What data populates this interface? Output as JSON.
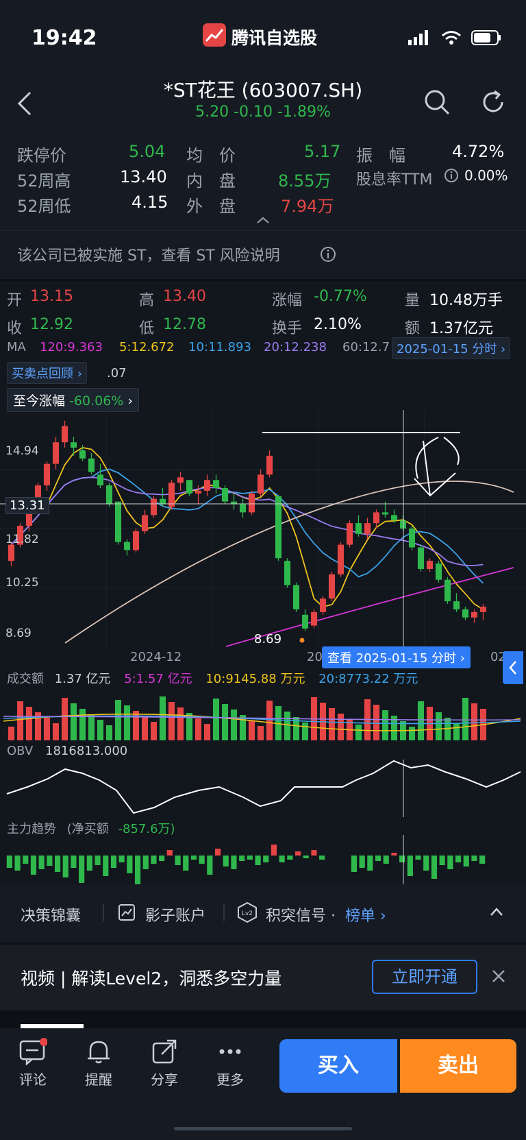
{
  "status": {
    "time": "19:42",
    "app_title": "腾讯自选股"
  },
  "header": {
    "name": "*ST花王 (603007.SH)",
    "price_line": "5.20  -0.10  -1.89%"
  },
  "quote": {
    "row1": {
      "l1": "跌停价",
      "v1": "5.04",
      "l2": "均　价",
      "v2": "5.17",
      "l3": "振　幅",
      "v3": "4.72%"
    },
    "row2": {
      "l1": "52周高",
      "v1": "13.40",
      "l2": "内　盘",
      "v2": "8.55万",
      "l3": "股息率TTM",
      "v3": "0.00%"
    },
    "row3": {
      "l1": "52周低",
      "v1": "4.15",
      "l2": "外　盘",
      "v2": "7.94万"
    }
  },
  "st_note": "该公司已被实施 ST，查看 ST 风险说明",
  "day_info": {
    "open_l": "开",
    "open": "13.15",
    "high_l": "高",
    "high": "13.40",
    "chg_l": "涨幅",
    "chg": "-0.77%",
    "vol_l": "量",
    "vol": "10.48万手",
    "close_l": "收",
    "close": "12.92",
    "low_l": "低",
    "low": "12.78",
    "turn_l": "换手",
    "turn": "2.10%",
    "amt_l": "额",
    "amt": "1.37亿元"
  },
  "ma_row": {
    "ma": "MA",
    "ma120": "120:9.363",
    "ma5": "5:12.672",
    "ma10": "10:11.893",
    "ma20": "20:12.238",
    "ma60": "60:12.7",
    "date": "2025-01-15 分时 ›"
  },
  "chips": {
    "review": "买卖点回顾 ›",
    "review_tail": ".07",
    "since": "至今涨幅",
    "since_val": "-60.06%"
  },
  "price_axis": {
    "p1": "14.94",
    "p2": "13.31",
    "p3": "11.82",
    "p4": "10.25",
    "p5": "8.69",
    "low_mark": "8.69"
  },
  "date_axis": {
    "d1": "2024-12",
    "d2": "20",
    "d3": "02",
    "view_btn": "查看 2025-01-15 分时 ›"
  },
  "volume": {
    "title": "成交额",
    "val": "1.37 亿元",
    "ma5": "5:1.57 亿元",
    "ma10": "10:9145.88 万元",
    "ma20": "20:8773.22 万元"
  },
  "obv": {
    "title": "OBV",
    "val": "1816813.000"
  },
  "main": {
    "title": "主力趋势",
    "paren": "(净买额",
    "val": "-857.6万)"
  },
  "bottombar": {
    "b1": "决策锦囊",
    "b2": "影子账户",
    "b3": "积突信号 ·",
    "b3_link": "榜单 ›"
  },
  "promo": {
    "text": "视频 | 解读Level2，洞悉多空力量",
    "btn": "立即开通"
  },
  "tabs": {
    "t1": "评论",
    "t2": "提醒",
    "t3": "分享",
    "t4": "更多",
    "buy": "买入",
    "sell": "卖出"
  },
  "colors": {
    "up": "#e64545",
    "down": "#2fb84c",
    "ma5": "#f0c419",
    "ma10": "#3aa3e8",
    "ma20": "#9a7cf0",
    "ma60": "#d9c2b5",
    "ma120": "#d636d6",
    "accent": "#2f7cf6"
  },
  "chart_data": {
    "type": "candlestick",
    "candles_ohlc": [
      [
        11.2,
        11.9,
        11.0,
        11.8
      ],
      [
        11.8,
        12.6,
        11.7,
        12.5
      ],
      [
        12.5,
        13.3,
        12.3,
        13.2
      ],
      [
        13.2,
        14.1,
        13.0,
        14.0
      ],
      [
        14.0,
        14.9,
        13.8,
        14.8
      ],
      [
        14.8,
        15.8,
        14.6,
        15.6
      ],
      [
        15.6,
        16.4,
        15.4,
        16.2
      ],
      [
        15.6,
        15.8,
        15.1,
        15.4
      ],
      [
        15.3,
        15.5,
        14.9,
        15.0
      ],
      [
        15.0,
        15.2,
        14.4,
        14.5
      ],
      [
        14.4,
        14.8,
        13.9,
        14.0
      ],
      [
        14.0,
        14.1,
        13.2,
        13.3
      ],
      [
        13.4,
        13.4,
        11.8,
        11.9
      ],
      [
        11.9,
        12.0,
        11.4,
        11.6
      ],
      [
        11.6,
        12.4,
        11.5,
        12.3
      ],
      [
        12.3,
        13.1,
        12.2,
        12.9
      ],
      [
        12.9,
        13.6,
        12.8,
        13.5
      ],
      [
        13.5,
        13.9,
        13.2,
        13.3
      ],
      [
        13.2,
        14.2,
        13.1,
        14.1
      ],
      [
        14.1,
        14.5,
        13.8,
        14.3
      ],
      [
        14.2,
        14.2,
        13.6,
        13.7
      ],
      [
        13.7,
        14.0,
        13.3,
        13.8
      ],
      [
        13.8,
        14.4,
        13.6,
        14.2
      ],
      [
        14.2,
        14.4,
        13.7,
        13.9
      ],
      [
        13.9,
        14.0,
        13.3,
        13.4
      ],
      [
        13.4,
        13.7,
        13.1,
        13.3
      ],
      [
        13.3,
        13.5,
        12.8,
        13.0
      ],
      [
        13.0,
        13.8,
        12.9,
        13.7
      ],
      [
        13.7,
        14.6,
        13.6,
        14.4
      ],
      [
        14.4,
        15.3,
        14.3,
        15.1
      ],
      [
        13.6,
        13.6,
        11.2,
        11.3
      ],
      [
        11.2,
        11.3,
        10.2,
        10.3
      ],
      [
        10.3,
        10.4,
        9.3,
        9.4
      ],
      [
        9.2,
        9.4,
        8.6,
        8.69
      ],
      [
        8.8,
        9.4,
        8.7,
        9.3
      ],
      [
        9.3,
        9.9,
        9.2,
        9.8
      ],
      [
        9.8,
        10.8,
        9.7,
        10.7
      ],
      [
        10.7,
        11.9,
        10.6,
        11.8
      ],
      [
        11.8,
        12.7,
        11.7,
        12.6
      ],
      [
        12.6,
        12.9,
        12.1,
        12.2
      ],
      [
        12.2,
        12.8,
        12.0,
        12.6
      ],
      [
        12.6,
        13.1,
        12.4,
        13.0
      ],
      [
        13.0,
        13.4,
        12.8,
        12.92
      ],
      [
        12.9,
        13.1,
        12.6,
        12.7
      ],
      [
        12.7,
        12.9,
        12.3,
        12.4
      ],
      [
        12.4,
        12.5,
        11.6,
        11.7
      ],
      [
        11.7,
        11.8,
        10.8,
        10.9
      ],
      [
        10.9,
        11.3,
        10.8,
        11.2
      ],
      [
        11.1,
        11.2,
        10.4,
        10.5
      ],
      [
        10.5,
        10.6,
        9.6,
        9.7
      ],
      [
        9.7,
        10.0,
        9.3,
        9.4
      ],
      [
        9.4,
        9.5,
        9.0,
        9.1
      ],
      [
        9.1,
        9.4,
        8.9,
        9.3
      ],
      [
        9.3,
        9.6,
        9.0,
        9.5
      ]
    ],
    "y_ticks": [
      14.94,
      13.31,
      11.82,
      10.25,
      8.69
    ],
    "x_labels": [
      "2024-12",
      "20",
      "02"
    ]
  }
}
